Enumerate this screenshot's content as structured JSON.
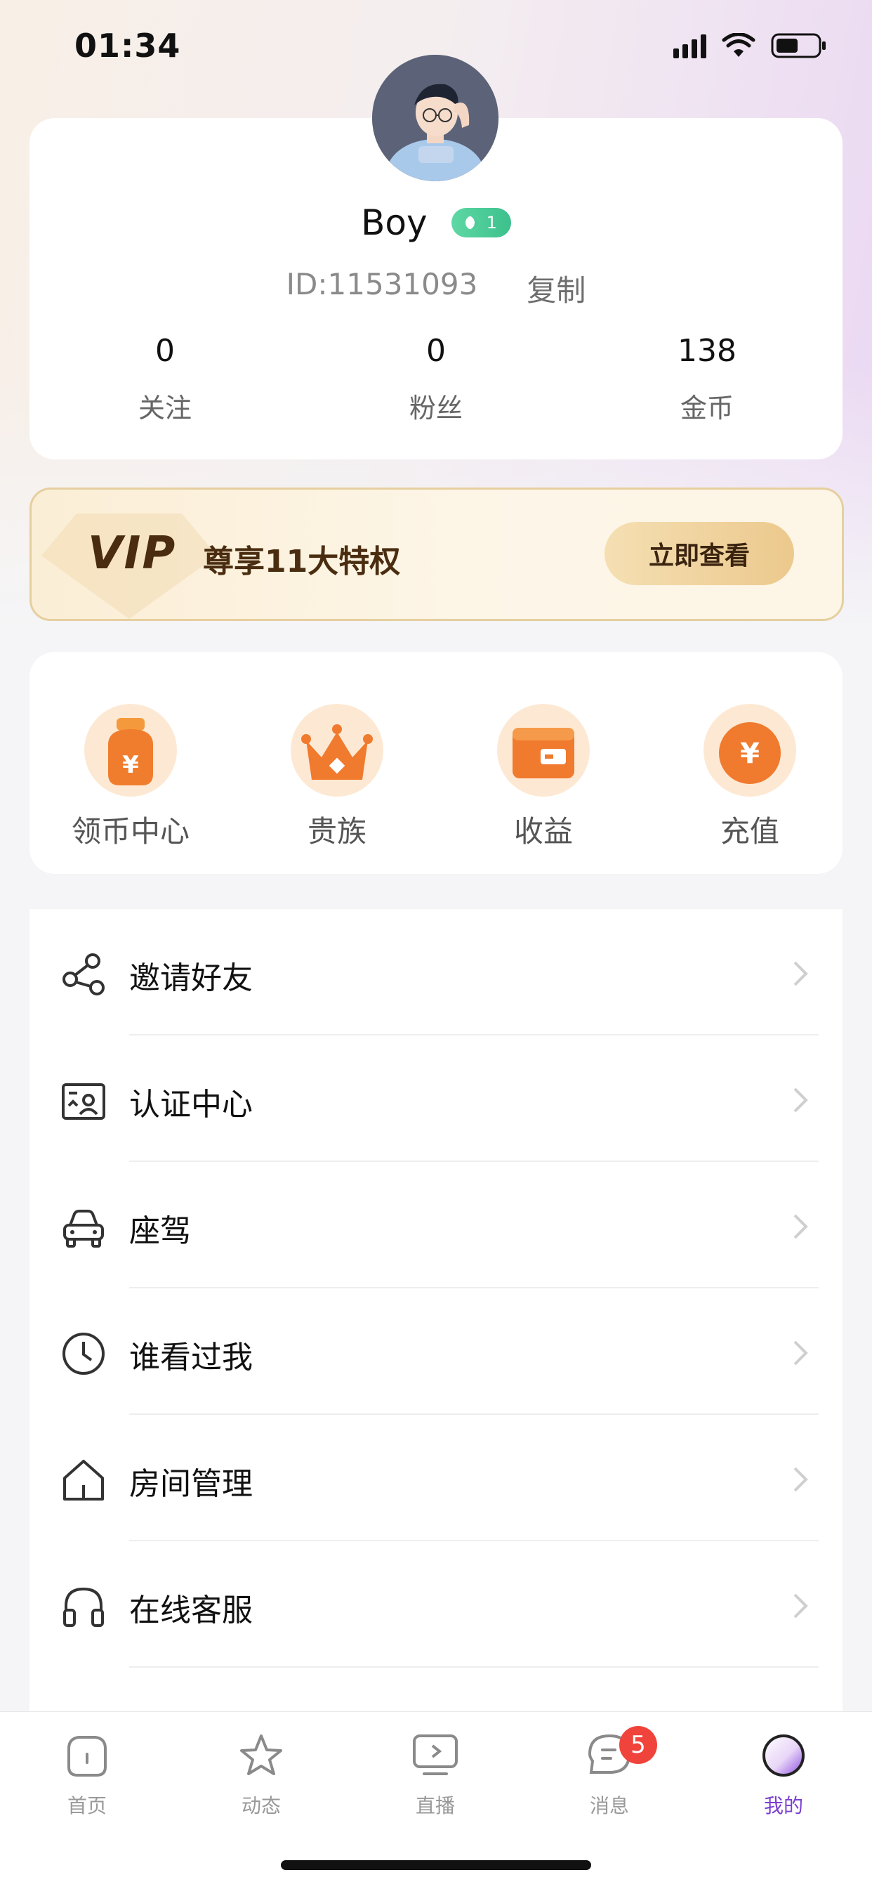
{
  "status_bar": {
    "time": "01:34"
  },
  "profile": {
    "name": "Boy",
    "level": "1",
    "id_text": "ID:11531093",
    "copy_label": "复制",
    "stats": [
      {
        "value": "0",
        "label": "关注"
      },
      {
        "value": "0",
        "label": "粉丝"
      },
      {
        "value": "138",
        "label": "金币"
      }
    ]
  },
  "vip": {
    "logo": "VIP",
    "text": "尊享11大特权",
    "button_label": "立即查看"
  },
  "quick_actions": [
    {
      "label": "领币中心",
      "icon": "money-bag-icon"
    },
    {
      "label": "贵族",
      "icon": "crown-icon"
    },
    {
      "label": "收益",
      "icon": "wallet-icon"
    },
    {
      "label": "充值",
      "icon": "coin-icon"
    }
  ],
  "menu": [
    {
      "label": "邀请好友",
      "icon": "share-icon"
    },
    {
      "label": "认证中心",
      "icon": "id-card-icon"
    },
    {
      "label": "座驾",
      "icon": "car-icon"
    },
    {
      "label": "谁看过我",
      "icon": "clock-icon"
    },
    {
      "label": "房间管理",
      "icon": "house-icon"
    },
    {
      "label": "在线客服",
      "icon": "headset-icon"
    }
  ],
  "tab_bar": {
    "tabs": [
      {
        "label": "首页",
        "icon": "home-icon"
      },
      {
        "label": "动态",
        "icon": "star-icon"
      },
      {
        "label": "直播",
        "icon": "live-tv-icon"
      },
      {
        "label": "消息",
        "icon": "message-icon",
        "badge": "5"
      },
      {
        "label": "我的",
        "icon": "profile-icon",
        "active": true
      }
    ]
  },
  "colors": {
    "accent": "#7b3fd1",
    "badge": "#f0433b",
    "level_badge": "#4fcd98",
    "vip_text": "#4a2d10"
  }
}
